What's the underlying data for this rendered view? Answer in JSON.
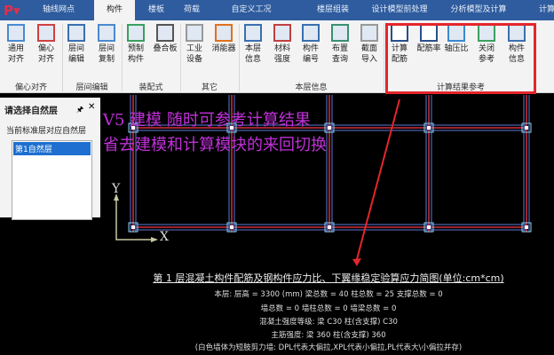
{
  "tabs": [
    {
      "label": "轴线网点"
    },
    {
      "label": "构件",
      "active": true
    },
    {
      "label": "楼板"
    },
    {
      "label": "荷载"
    },
    {
      "label": "自定义工况"
    },
    {
      "label": "楼层组装"
    },
    {
      "label": "设计模型前处理"
    },
    {
      "label": "分析模型及计算"
    },
    {
      "label": "计算"
    }
  ],
  "ribbon": {
    "buttons": [
      {
        "l1": "通用",
        "l2": "对齐",
        "icon": "align-icon"
      },
      {
        "l1": "偏心",
        "l2": "对齐",
        "icon": "eccentric-align-icon"
      },
      {
        "l1": "层间",
        "l2": "编辑",
        "icon": "floor-edit-icon"
      },
      {
        "l1": "层间",
        "l2": "复制",
        "icon": "floor-copy-icon"
      },
      {
        "l1": "预制",
        "l2": "构件",
        "icon": "precast-member-icon"
      },
      {
        "l1": "叠合板",
        "l2": "",
        "icon": "composite-slab-icon"
      },
      {
        "l1": "工业",
        "l2": "设备",
        "icon": "industrial-equipment-icon"
      },
      {
        "l1": "消能器",
        "l2": "",
        "icon": "damper-icon"
      },
      {
        "l1": "本层",
        "l2": "信息",
        "icon": "floor-info-icon"
      },
      {
        "l1": "材料",
        "l2": "强度",
        "icon": "material-strength-icon"
      },
      {
        "l1": "构件",
        "l2": "编号",
        "icon": "member-number-icon"
      },
      {
        "l1": "布置",
        "l2": "查询",
        "icon": "layout-query-icon"
      },
      {
        "l1": "截面",
        "l2": "导入",
        "icon": "section-import-icon"
      },
      {
        "l1": "计算",
        "l2": "配筋",
        "icon": "calc-reinforcement-icon"
      },
      {
        "l1": "配筋率",
        "l2": "",
        "icon": "reinforcement-ratio-icon"
      },
      {
        "l1": "轴压比",
        "l2": "",
        "icon": "axial-ratio-icon"
      },
      {
        "l1": "关闭",
        "l2": "参考",
        "icon": "close-reference-icon"
      },
      {
        "l1": "构件",
        "l2": "信息",
        "icon": "member-info-icon"
      }
    ],
    "groups": [
      "偏心对齐",
      "层间编辑",
      "装配式",
      "其它",
      "本层信息",
      "计算结果参考"
    ]
  },
  "panel": {
    "title": "请选择自然层",
    "subtitle": "当前标准层对应自然层",
    "items": [
      "第1自然层"
    ]
  },
  "overlay": {
    "line1": "V5 建模 随时可参考计算结果",
    "line2": "省去建模和计算模块的来回切换"
  },
  "axes": {
    "x": "X",
    "y": "Y"
  },
  "info": {
    "title": "第 1 层混凝土构件配筋及钢构件应力比、下翼缘稳定验算应力简图(单位:cm*cm)",
    "lines": [
      "本层: 层高 = 3300 (mm)  梁总数 = 40  柱总数 = 25  支撑总数 = 0",
      "墙总数 = 0  墙柱总数 = 0  墙梁总数 = 0",
      "混凝土强度等级: 梁 C30   柱(含支撑) C30",
      "主筋强度: 梁 360   柱(含支撑) 360",
      "(白色墙体为短肢剪力墙: DPL代表大偏拉,XPL代表小偏拉,PL代表大\\小偏拉并存)"
    ]
  },
  "colors": {
    "tabbar": "#2e5c9e",
    "highlight": "#e3262b",
    "annotation": "#c030d8"
  }
}
